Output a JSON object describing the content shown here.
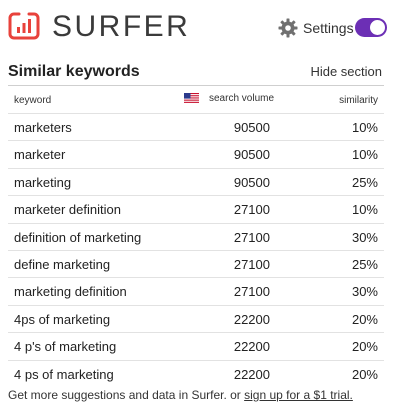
{
  "header": {
    "brand": "SURFER",
    "settings_label": "Settings",
    "toggle_on": true,
    "accent_color": "#6c2fb5",
    "logo_color": "#e8423b"
  },
  "section": {
    "title": "Similar keywords",
    "hide_label": "Hide section"
  },
  "table": {
    "columns": {
      "keyword": "keyword",
      "volume": "search volume",
      "similarity": "similarity"
    },
    "flag_icon": "us-flag-icon",
    "rows": [
      {
        "keyword": "marketers",
        "volume": "90500",
        "similarity": "10%"
      },
      {
        "keyword": "marketer",
        "volume": "90500",
        "similarity": "10%"
      },
      {
        "keyword": "marketing",
        "volume": "90500",
        "similarity": "25%"
      },
      {
        "keyword": "marketer definition",
        "volume": "27100",
        "similarity": "10%"
      },
      {
        "keyword": "definition of marketing",
        "volume": "27100",
        "similarity": "30%"
      },
      {
        "keyword": "define marketing",
        "volume": "27100",
        "similarity": "25%"
      },
      {
        "keyword": "marketing definition",
        "volume": "27100",
        "similarity": "30%"
      },
      {
        "keyword": "4ps of marketing",
        "volume": "22200",
        "similarity": "20%"
      },
      {
        "keyword": "4 p's of marketing",
        "volume": "22200",
        "similarity": "20%"
      },
      {
        "keyword": "4 ps of marketing",
        "volume": "22200",
        "similarity": "20%"
      }
    ]
  },
  "footer": {
    "text": "Get more suggestions and data in Surfer. or ",
    "link_text": "sign up for a $1 trial."
  }
}
